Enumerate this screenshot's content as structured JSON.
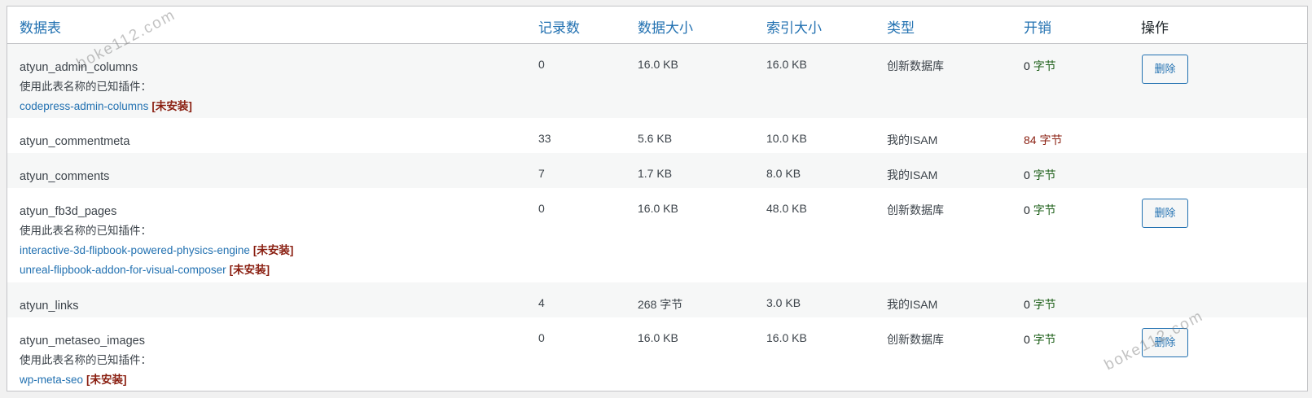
{
  "headers": {
    "table": "数据表",
    "rows": "记录数",
    "data_size": "数据大小",
    "index_size": "索引大小",
    "type": "类型",
    "overhead": "开销",
    "action": "操作"
  },
  "rows": [
    {
      "name": "atyun_admin_columns",
      "note": "使用此表名称的已知插件：",
      "plugins": [
        {
          "slug": "codepress-admin-columns",
          "status": "[未安装]"
        }
      ],
      "records": "0",
      "data_size": "16.0 KB",
      "index_size": "16.0 KB",
      "type": "创新数据库",
      "overhead_num": "0",
      "overhead_unit": "字节",
      "action": "删除"
    },
    {
      "name": "atyun_commentmeta",
      "records": "33",
      "data_size": "5.6 KB",
      "index_size": "10.0 KB",
      "type": "我的ISAM",
      "overhead_num": "84",
      "overhead_unit": "字节"
    },
    {
      "name": "atyun_comments",
      "records": "7",
      "data_size": "1.7 KB",
      "index_size": "8.0 KB",
      "type": "我的ISAM",
      "overhead_num": "0",
      "overhead_unit": "字节"
    },
    {
      "name": "atyun_fb3d_pages",
      "note": "使用此表名称的已知插件：",
      "plugins": [
        {
          "slug": "interactive-3d-flipbook-powered-physics-engine",
          "status": "[未安装]"
        },
        {
          "slug": "unreal-flipbook-addon-for-visual-composer",
          "status": "[未安装]"
        }
      ],
      "records": "0",
      "data_size": "16.0 KB",
      "index_size": "48.0 KB",
      "type": "创新数据库",
      "overhead_num": "0",
      "overhead_unit": "字节",
      "action": "删除"
    },
    {
      "name": "atyun_links",
      "records": "4",
      "data_size": "268 字节",
      "index_size": "3.0 KB",
      "type": "我的ISAM",
      "overhead_num": "0",
      "overhead_unit": "字节"
    },
    {
      "name": "atyun_metaseo_images",
      "note": "使用此表名称的已知插件：",
      "plugins": [
        {
          "slug": "wp-meta-seo",
          "status": "[未安装]"
        }
      ],
      "records": "0",
      "data_size": "16.0 KB",
      "index_size": "16.0 KB",
      "type": "创新数据库",
      "overhead_num": "0",
      "overhead_unit": "字节",
      "action": "删除"
    }
  ],
  "watermarks": [
    "boke112.com",
    "boke112.com"
  ],
  "colors": {
    "link": "#2271b1",
    "not_installed": "#8a1f11",
    "overhead_bad": "#8a1f11",
    "overhead_ok": "#1d5f19",
    "row_alt": "#f6f7f7",
    "border": "#c3c4c7"
  }
}
